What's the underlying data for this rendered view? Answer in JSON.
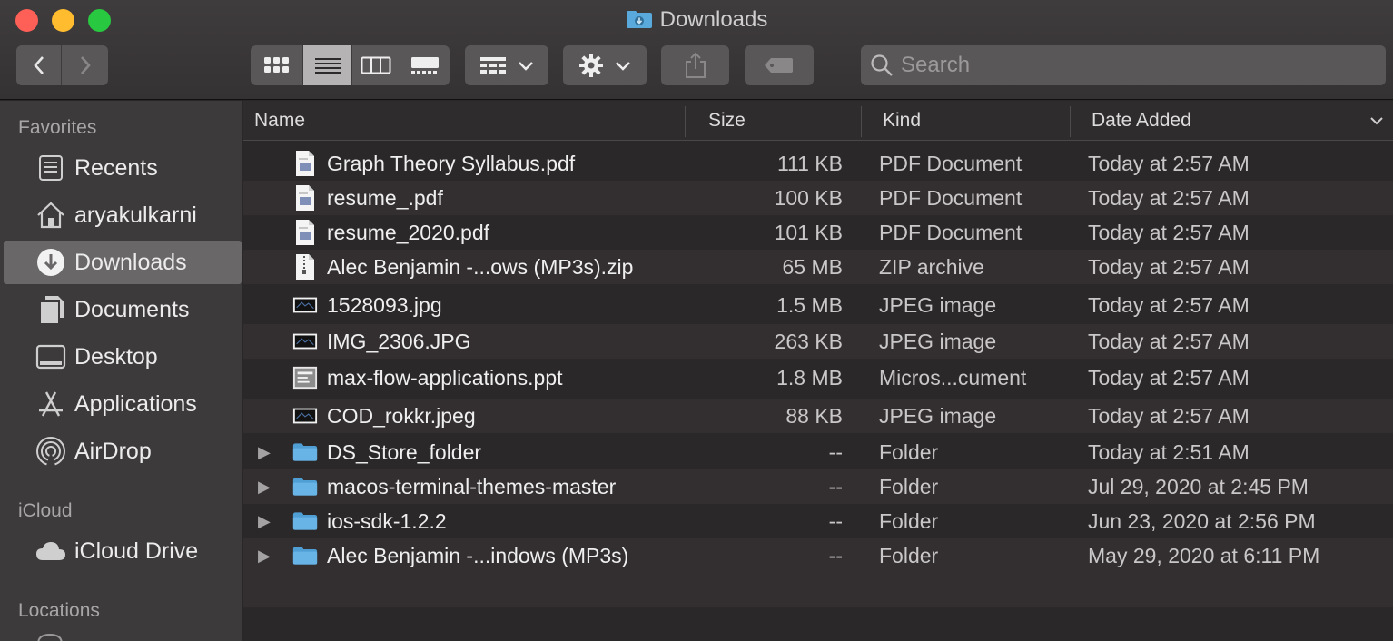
{
  "window": {
    "title": "Downloads"
  },
  "toolbar": {
    "search_placeholder": "Search"
  },
  "sidebar": {
    "favorites_heading": "Favorites",
    "favorites": [
      {
        "label": "Recents",
        "icon": "recents-icon"
      },
      {
        "label": "aryakulkarni",
        "icon": "home-icon"
      },
      {
        "label": "Downloads",
        "icon": "downloads-icon",
        "selected": true
      },
      {
        "label": "Documents",
        "icon": "documents-icon"
      },
      {
        "label": "Desktop",
        "icon": "desktop-icon"
      },
      {
        "label": "Applications",
        "icon": "applications-icon"
      },
      {
        "label": "AirDrop",
        "icon": "airdrop-icon"
      }
    ],
    "icloud_heading": "iCloud",
    "icloud": [
      {
        "label": "iCloud Drive",
        "icon": "cloud-icon"
      }
    ],
    "locations_heading": "Locations"
  },
  "columns": {
    "name": "Name",
    "size": "Size",
    "kind": "Kind",
    "date": "Date Added"
  },
  "files": [
    {
      "name": "Graph Theory Syllabus.pdf",
      "size": "111 KB",
      "kind": "PDF Document",
      "date": "Today at 2:57 AM",
      "icon": "pdf-file-icon",
      "folder": false
    },
    {
      "name": "resume_.pdf",
      "size": "100 KB",
      "kind": "PDF Document",
      "date": "Today at 2:57 AM",
      "icon": "pdf-file-icon",
      "folder": false
    },
    {
      "name": "resume_2020.pdf",
      "size": "101 KB",
      "kind": "PDF Document",
      "date": "Today at 2:57 AM",
      "icon": "pdf-file-icon",
      "folder": false
    },
    {
      "name": "Alec Benjamin -...ows (MP3s).zip",
      "size": "65 MB",
      "kind": "ZIP archive",
      "date": "Today at 2:57 AM",
      "icon": "zip-file-icon",
      "folder": false
    },
    {
      "name": "1528093.jpg",
      "size": "1.5 MB",
      "kind": "JPEG image",
      "date": "Today at 2:57 AM",
      "icon": "image-file-icon",
      "folder": false
    },
    {
      "name": "IMG_2306.JPG",
      "size": "263 KB",
      "kind": "JPEG image",
      "date": "Today at 2:57 AM",
      "icon": "image-file-icon",
      "folder": false
    },
    {
      "name": "max-flow-applications.ppt",
      "size": "1.8 MB",
      "kind": "Micros...cument",
      "date": "Today at 2:57 AM",
      "icon": "ppt-file-icon",
      "folder": false
    },
    {
      "name": "COD_rokkr.jpeg",
      "size": "88 KB",
      "kind": "JPEG image",
      "date": "Today at 2:57 AM",
      "icon": "image-file-icon",
      "folder": false
    },
    {
      "name": "DS_Store_folder",
      "size": "--",
      "kind": "Folder",
      "date": "Today at 2:51 AM",
      "icon": "folder-icon",
      "folder": true
    },
    {
      "name": "macos-terminal-themes-master",
      "size": "--",
      "kind": "Folder",
      "date": "Jul 29, 2020 at 2:45 PM",
      "icon": "folder-icon",
      "folder": true
    },
    {
      "name": "ios-sdk-1.2.2",
      "size": "--",
      "kind": "Folder",
      "date": "Jun 23, 2020 at 2:56 PM",
      "icon": "folder-icon",
      "folder": true
    },
    {
      "name": "Alec Benjamin -...indows (MP3s)",
      "size": "--",
      "kind": "Folder",
      "date": "May 29, 2020 at 6:11 PM",
      "icon": "folder-icon",
      "folder": true
    }
  ]
}
